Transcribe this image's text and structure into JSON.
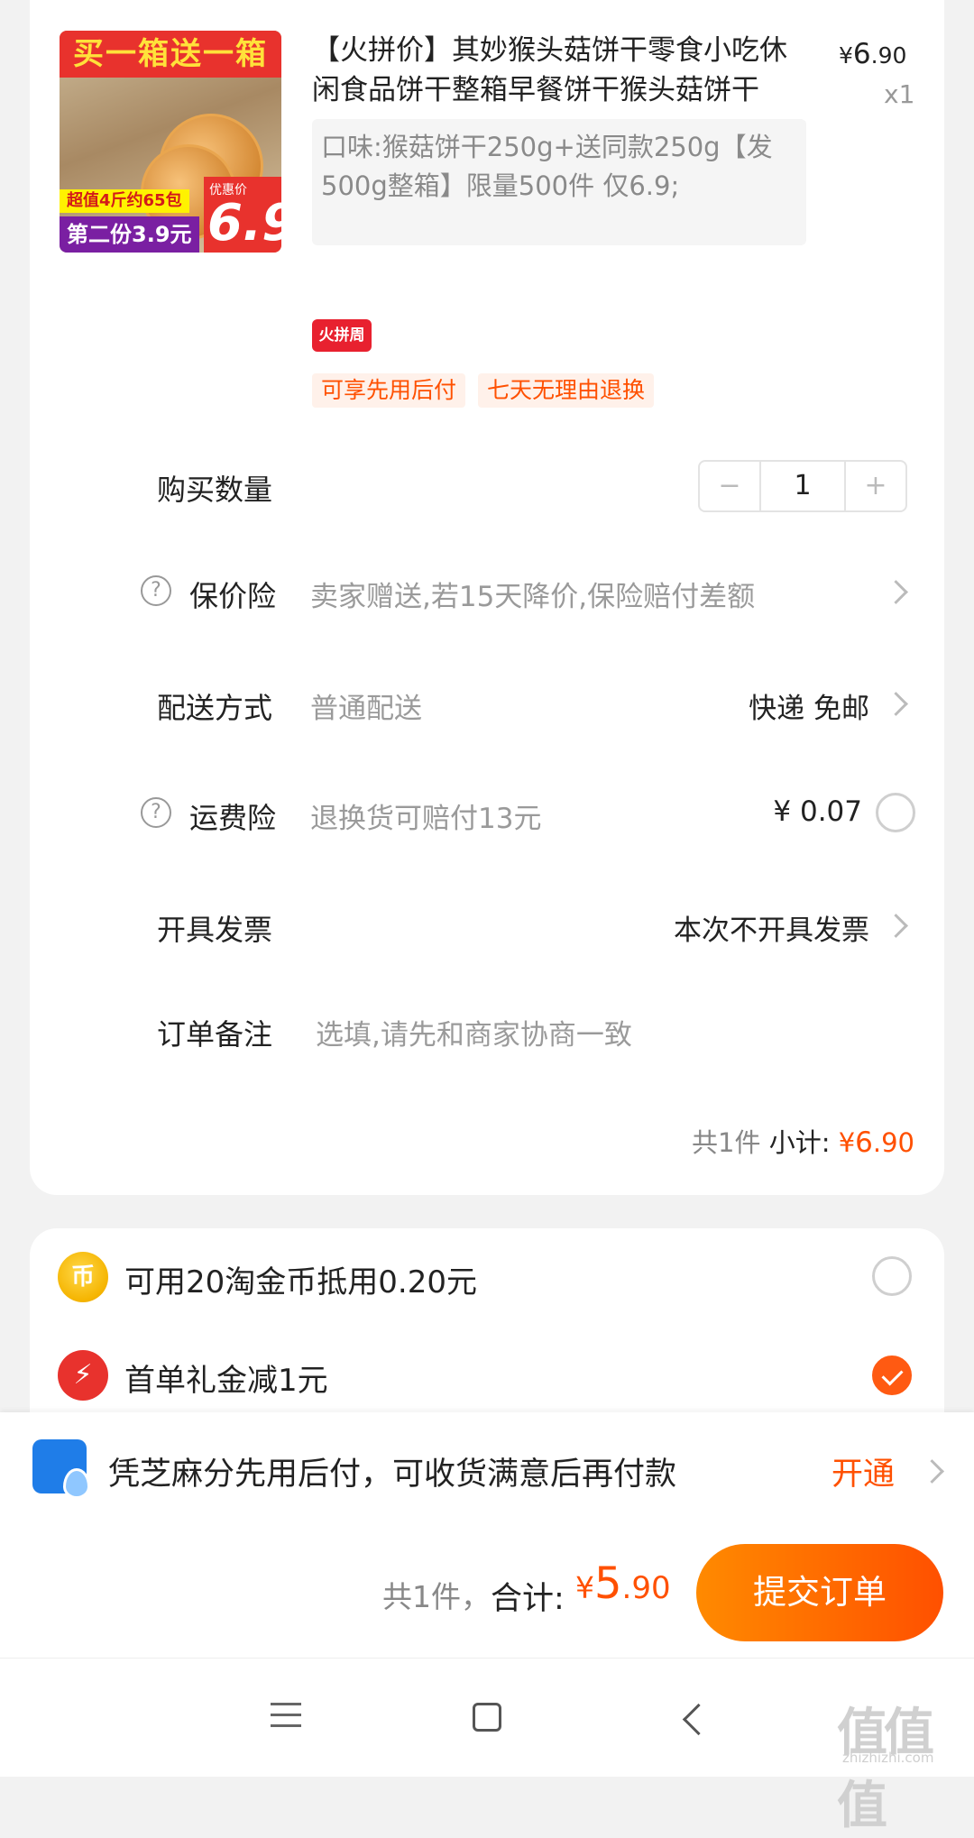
{
  "product": {
    "thumb": {
      "banner": "买一箱送一箱",
      "tag_top": "超值4斤约65包",
      "tag_bottom": "第二份3.9元",
      "price_label": "优惠价",
      "price": "6.9"
    },
    "title": "【火拼价】其妙猴头菇饼干零食小吃休闲食品饼干整箱早餐饼干猴头菇饼干",
    "price_symbol": "¥",
    "price_int": "6",
    "price_dec": ".90",
    "quantity_text": "x1",
    "spec": "口味:猴菇饼干250g+送同款250g【发500g整箱】限量500件 仅6.9;",
    "promo_badge": "火拼周",
    "service_tags": [
      "可享先用后付",
      "七天无理由退换"
    ]
  },
  "rows": {
    "quantity": {
      "label": "购买数量",
      "value": "1",
      "minus": "−",
      "plus": "+"
    },
    "price_protect": {
      "label": "保价险",
      "desc": "卖家赠送,若15天降价,保险赔付差额"
    },
    "delivery": {
      "label": "配送方式",
      "desc": "普通配送",
      "value": "快递 免邮"
    },
    "freight_insurance": {
      "label": "运费险",
      "desc": "退换货可赔付13元",
      "value": "¥ 0.07"
    },
    "invoice": {
      "label": "开具发票",
      "value": "本次不开具发票"
    },
    "note": {
      "label": "订单备注",
      "placeholder": "选填,请先和商家协商一致"
    }
  },
  "subtotal": {
    "count": "共1件",
    "label": "小计:",
    "symbol": "¥",
    "int": "6",
    "dec": ".90"
  },
  "discounts": {
    "coin_text": "可用20淘金币抵用0.20元",
    "coin_icon": "币",
    "gift_text": "首单礼金减1元",
    "gift_checked": true
  },
  "pay_later": {
    "text": "凭芝麻分先用后付，可收货满意后再付款",
    "action": "开通"
  },
  "checkout": {
    "count": "共1件，",
    "label": "合计:",
    "symbol": "¥",
    "int": "5",
    "dec": ".90",
    "submit": "提交订单"
  },
  "watermark": {
    "big": "值值值",
    "small": "zhizhizhi.com"
  },
  "colors": {
    "accent": "#ff5000",
    "badge_red": "#e8212f",
    "pay_blue": "#1f7de8"
  }
}
